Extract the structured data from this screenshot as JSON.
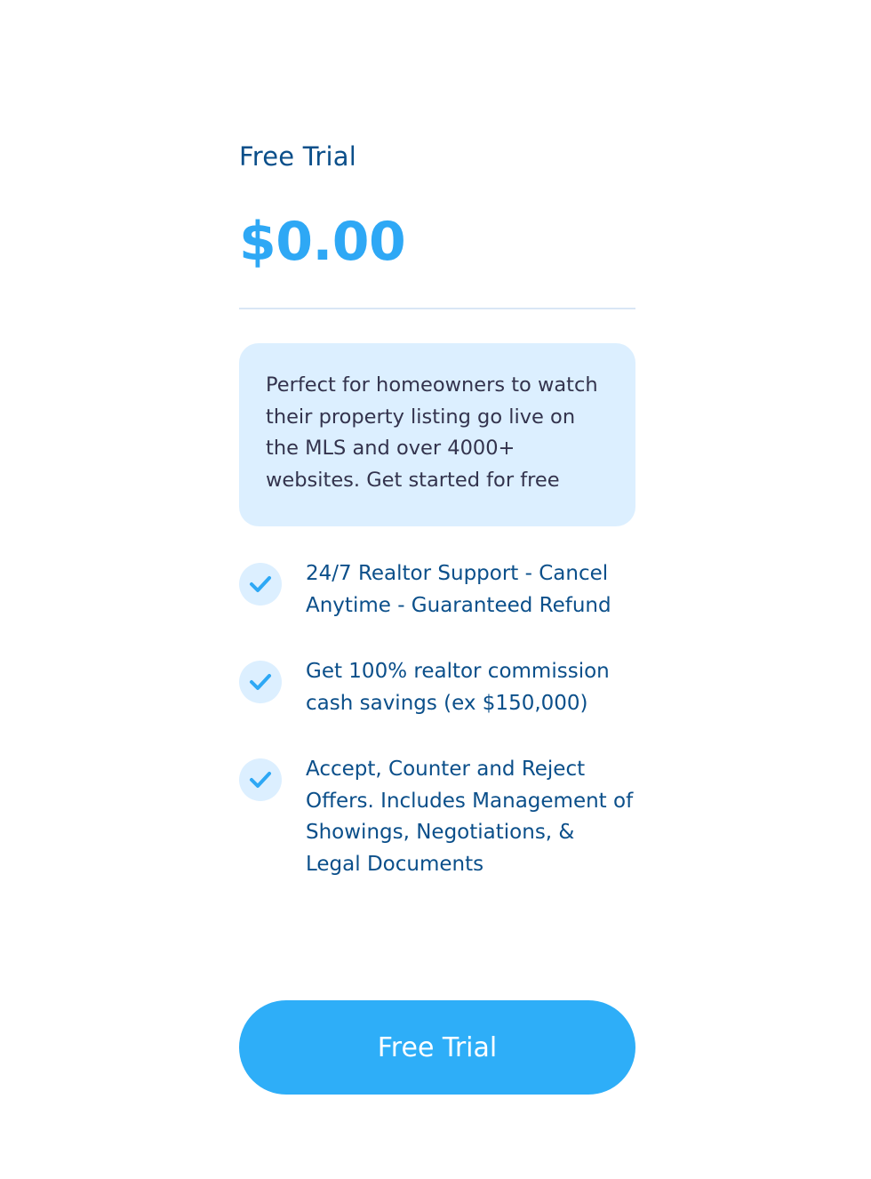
{
  "plan": {
    "title": "Free Trial",
    "price": "$0.00",
    "description": "Perfect for homeowners to watch their property listing go live on the MLS and over 4000+ websites. Get started for free"
  },
  "features": [
    {
      "icon": "checkmark-icon",
      "text": "24/7 Realtor Support - Cancel Anytime - Guaranteed Refund"
    },
    {
      "icon": "checkmark-icon",
      "text": "Get 100% realtor commission cash savings (ex $150,000)"
    },
    {
      "icon": "checkmark-icon",
      "text": "Accept, Counter and Reject Offers. Includes Management of Showings, Negotiations, & Legal Documents"
    }
  ],
  "cta": {
    "label": "Free Trial"
  },
  "colors": {
    "title": "#0b4f8a",
    "price": "#2ea8f5",
    "button": "#2eaef8",
    "description_bg": "#dcefff"
  }
}
